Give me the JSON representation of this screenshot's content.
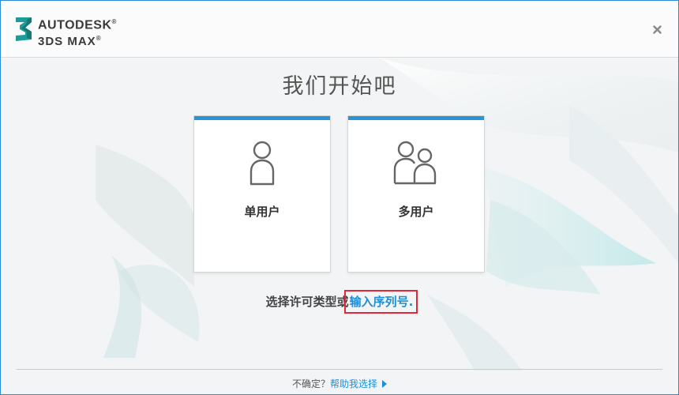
{
  "header": {
    "logo_line1": "AUTODESK",
    "logo_line1_mark": "®",
    "logo_line2": "3DS MAX",
    "logo_line2_mark": "®",
    "logo_icon": "3ds-max-3-icon",
    "close_icon": "close-icon"
  },
  "main": {
    "title": "我们开始吧",
    "cards": [
      {
        "label": "单用户",
        "icon": "single-user-icon"
      },
      {
        "label": "多用户",
        "icon": "multi-user-icon"
      }
    ],
    "license_prompt": "选择许可类型或",
    "serial_link": "输入序列号",
    "serial_suffix": "."
  },
  "footer": {
    "question": "不确定？",
    "help_link": "帮助我选择",
    "arrow_icon": "triangle-right-icon"
  },
  "colors": {
    "accent": "#2a93d5",
    "link": "#1e8fd8",
    "highlight": "#e0283a",
    "window_border": "#2b8bd6"
  }
}
